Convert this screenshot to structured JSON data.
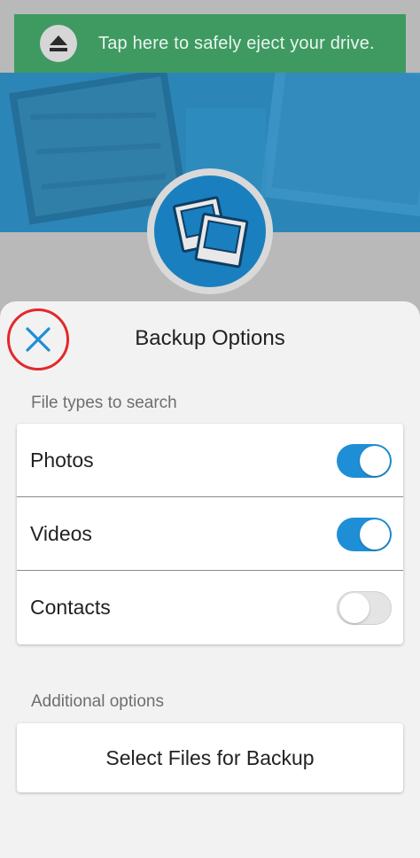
{
  "banner": {
    "text": "Tap here to safely eject your drive.",
    "icon": "eject-icon",
    "color": "#3f9a62"
  },
  "hero": {
    "icon": "photos-icon",
    "accent": "#1a7fbe"
  },
  "sheet": {
    "title": "Backup Options",
    "close_icon": "close-icon",
    "file_types_label": "File types to search",
    "file_types": [
      {
        "label": "Photos",
        "enabled": true
      },
      {
        "label": "Videos",
        "enabled": true
      },
      {
        "label": "Contacts",
        "enabled": false
      }
    ],
    "additional_label": "Additional options",
    "select_files_label": "Select Files for Backup"
  },
  "colors": {
    "toggle_on": "#1e8fd6",
    "close_highlight": "#e3282b"
  }
}
